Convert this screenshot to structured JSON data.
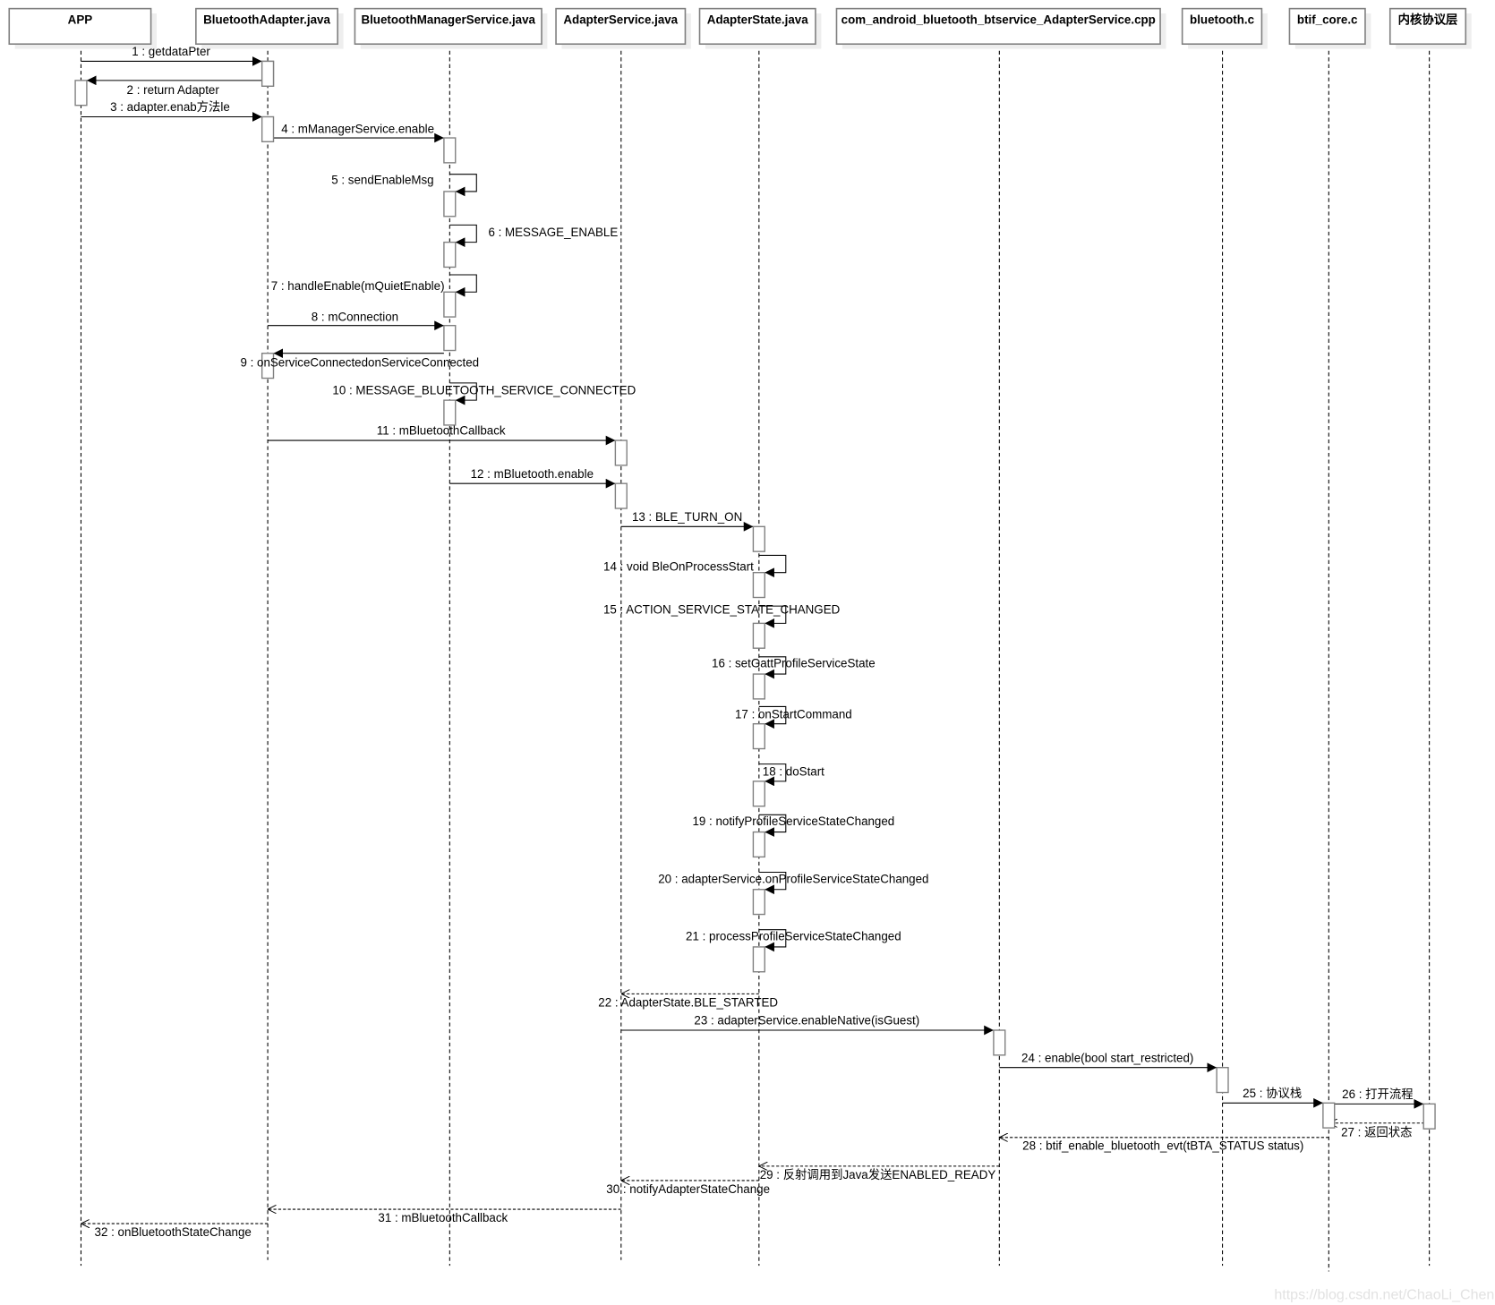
{
  "participants": [
    "APP",
    "BluetoothAdapter.java",
    "BluetoothManagerService.java",
    "AdapterService.java",
    "AdapterState.java",
    "com_android_bluetooth_btservice_AdapterService.cpp",
    "bluetooth.c",
    "btif_core.c",
    "内核协议层"
  ],
  "messages": [
    {
      "label": "1 : getdataPter",
      "from": 0,
      "to": 1,
      "kind": "sync"
    },
    {
      "label": "2 : return Adapter",
      "from": 1,
      "to": 0,
      "kind": "sync"
    },
    {
      "label": "3 : adapter.enab方法le",
      "from": 0,
      "to": 1,
      "kind": "sync"
    },
    {
      "label": "4 : mManagerService.enable",
      "from": 1,
      "to": 2,
      "kind": "sync"
    },
    {
      "label": "5 : sendEnableMsg",
      "from": 2,
      "to": 2,
      "kind": "self"
    },
    {
      "label": "6 : MESSAGE_ENABLE",
      "from": 2,
      "to": 2,
      "kind": "self"
    },
    {
      "label": "7 : handleEnable(mQuietEnable)",
      "from": 2,
      "to": 2,
      "kind": "self"
    },
    {
      "label": "8 : mConnection",
      "from": 1,
      "to": 2,
      "kind": "sync"
    },
    {
      "label": "9 : onServiceConnectedonServiceConnected",
      "from": 2,
      "to": 1,
      "kind": "sync"
    },
    {
      "label": "10 : MESSAGE_BLUETOOTH_SERVICE_CONNECTED",
      "from": 2,
      "to": 2,
      "kind": "self"
    },
    {
      "label": "11 : mBluetoothCallback",
      "from": 1,
      "to": 3,
      "kind": "sync"
    },
    {
      "label": "12 : mBluetooth.enable",
      "from": 2,
      "to": 3,
      "kind": "sync"
    },
    {
      "label": "13 : BLE_TURN_ON",
      "from": 3,
      "to": 4,
      "kind": "sync"
    },
    {
      "label": "14 : void BleOnProcessStart",
      "from": 4,
      "to": 4,
      "kind": "self"
    },
    {
      "label": "15 : ACTION_SERVICE_STATE_CHANGED",
      "from": 4,
      "to": 4,
      "kind": "self"
    },
    {
      "label": "16 : setGattProfileServiceState",
      "from": 4,
      "to": 4,
      "kind": "self"
    },
    {
      "label": "17 : onStartCommand",
      "from": 4,
      "to": 4,
      "kind": "self"
    },
    {
      "label": "18 : doStart",
      "from": 4,
      "to": 4,
      "kind": "self"
    },
    {
      "label": "19 : notifyProfileServiceStateChanged",
      "from": 4,
      "to": 4,
      "kind": "self"
    },
    {
      "label": "20 : adapterService.onProfileServiceStateChanged",
      "from": 4,
      "to": 4,
      "kind": "self"
    },
    {
      "label": "21 : processProfileServiceStateChanged",
      "from": 4,
      "to": 4,
      "kind": "self"
    },
    {
      "label": "22 : AdapterState.BLE_STARTED",
      "from": 4,
      "to": 3,
      "kind": "return"
    },
    {
      "label": "23 : adapterService.enableNative(isGuest)",
      "from": 3,
      "to": 5,
      "kind": "sync"
    },
    {
      "label": "24 : enable(bool start_restricted)",
      "from": 5,
      "to": 6,
      "kind": "sync"
    },
    {
      "label": "25 : 协议栈",
      "from": 6,
      "to": 7,
      "kind": "sync"
    },
    {
      "label": "26 : 打开流程",
      "from": 7,
      "to": 8,
      "kind": "sync"
    },
    {
      "label": "27 : 返回状态",
      "from": 8,
      "to": 7,
      "kind": "return"
    },
    {
      "label": "28 : btif_enable_bluetooth_evt(tBTA_STATUS status)",
      "from": 7,
      "to": 5,
      "kind": "return"
    },
    {
      "label": "29 : 反射调用到Java发送ENABLED_READY",
      "from": 5,
      "to": 4,
      "kind": "return"
    },
    {
      "label": "30 : notifyAdapterStateChange",
      "from": 4,
      "to": 3,
      "kind": "return"
    },
    {
      "label": "31 : mBluetoothCallback",
      "from": 3,
      "to": 1,
      "kind": "return"
    },
    {
      "label": "32 : onBluetoothStateChange",
      "from": 1,
      "to": 0,
      "kind": "return"
    }
  ],
  "watermark": "https://blog.csdn.net/ChaoLi_Chen",
  "colors": {
    "line": "#000000",
    "box_border": "#808080",
    "shadow": "#eeeeee",
    "watermark": "#e2e2e2"
  }
}
